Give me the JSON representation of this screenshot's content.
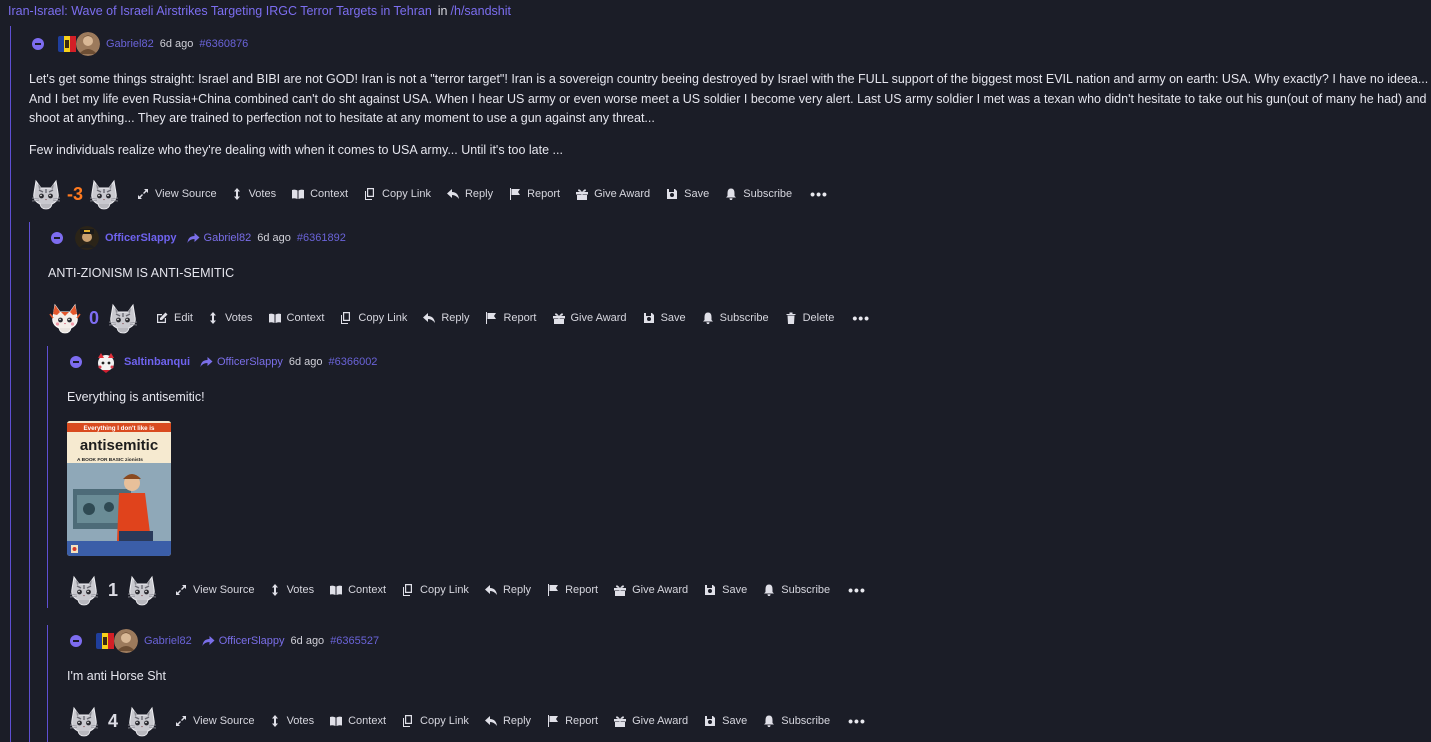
{
  "post": {
    "title": "Iran-Israel: Wave of Israeli Airstrikes Targeting IRGC Terror Targets in Tehran",
    "in_label": "in",
    "hole": "/h/sandshit"
  },
  "colors": {
    "accent": "#7d6cf0",
    "downvoted": "#ff7a1f",
    "background": "#1b1d27"
  },
  "comments": [
    {
      "username": "Gabriel82",
      "reply_to": "",
      "time": "6d ago",
      "id": "#6360876",
      "body": [
        "Let's get some things straight: Israel and BIBI are not GOD! Iran is not a \"terror target\"! Iran is a sovereign country beeing destroyed by Israel with the FULL support of the biggest most EVIL nation and army on earth: USA. Why exactly? I have no ideea... And I bet my life even Russia+China combined can't do sht against USA. When I hear US army or even worse meet a US soldier I become very alert. Last US army soldier I met was a texan who didn't hesitate to take out his gun(out of many he had) and shoot at anything... They are trained to perfection not to hesitate at any moment to use a gun against any threat...",
        "Few individuals realize who they're dealing with when it comes to USA army... Until it's too late ..."
      ],
      "score": "-3",
      "actions": [
        "View Source",
        "Votes",
        "Context",
        "Copy Link",
        "Reply",
        "Report",
        "Give Award",
        "Save",
        "Subscribe"
      ]
    },
    {
      "username": "OfficerSlappy",
      "reply_to": "Gabriel82",
      "time": "6d ago",
      "id": "#6361892",
      "body": [
        "ANTI-ZIONISM IS ANTI-SEMITIC"
      ],
      "score": "0",
      "actions": [
        "Edit",
        "Votes",
        "Context",
        "Copy Link",
        "Reply",
        "Report",
        "Give Award",
        "Save",
        "Subscribe",
        "Delete"
      ]
    },
    {
      "username": "Saltinbanqui",
      "reply_to": "OfficerSlappy",
      "time": "6d ago",
      "id": "#6366002",
      "body": [
        "Everything is antisemitic!"
      ],
      "image": {
        "line1": "Everything I don't like is",
        "line2": "antisemitic",
        "line3": "A BOOK FOR BASIC zionists"
      },
      "score": "1",
      "actions": [
        "View Source",
        "Votes",
        "Context",
        "Copy Link",
        "Reply",
        "Report",
        "Give Award",
        "Save",
        "Subscribe"
      ]
    },
    {
      "username": "Gabriel82",
      "reply_to": "OfficerSlappy",
      "time": "6d ago",
      "id": "#6365527",
      "body": [
        "I'm anti Horse Sht"
      ],
      "score": "4",
      "actions": [
        "View Source",
        "Votes",
        "Context",
        "Copy Link",
        "Reply",
        "Report",
        "Give Award",
        "Save",
        "Subscribe"
      ]
    }
  ],
  "more_label": "•••"
}
